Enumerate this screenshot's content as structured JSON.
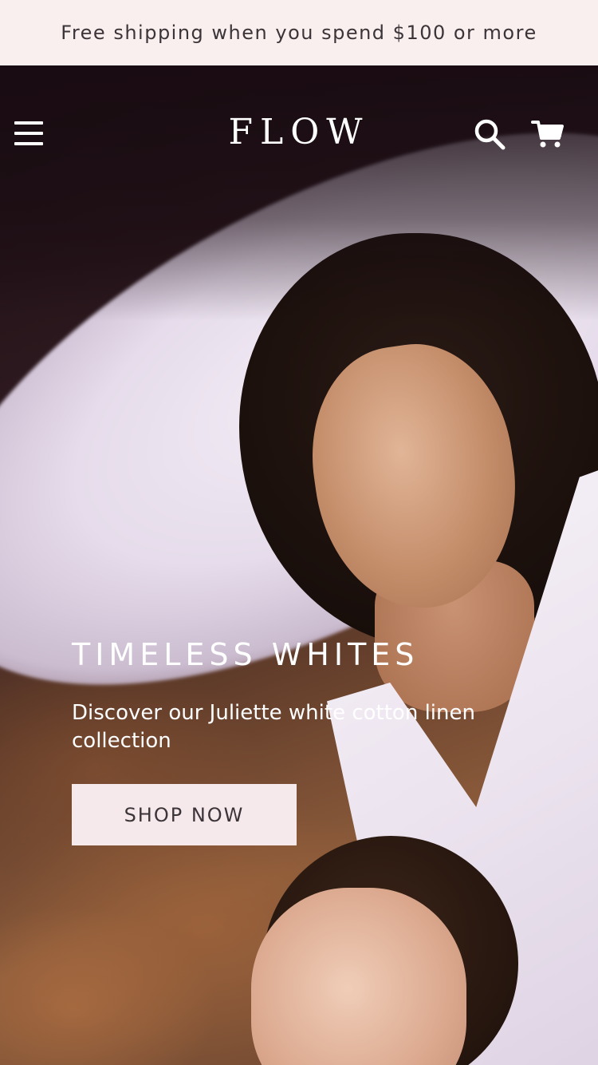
{
  "announcement": {
    "text": "Free shipping when you spend $100 or more"
  },
  "header": {
    "logo": "FLOW",
    "menu_icon": "hamburger-menu-icon",
    "search_icon": "search-icon",
    "cart_icon": "cart-icon"
  },
  "hero": {
    "title": "TIMELESS WHITES",
    "subtitle": "Discover our Juliette white cotton linen collection",
    "cta_label": "SHOP NOW"
  },
  "colors": {
    "announcement_bg": "#f8efee",
    "button_bg": "#f6e9eb",
    "text_dark": "#3b3438",
    "text_light": "#ffffff"
  }
}
